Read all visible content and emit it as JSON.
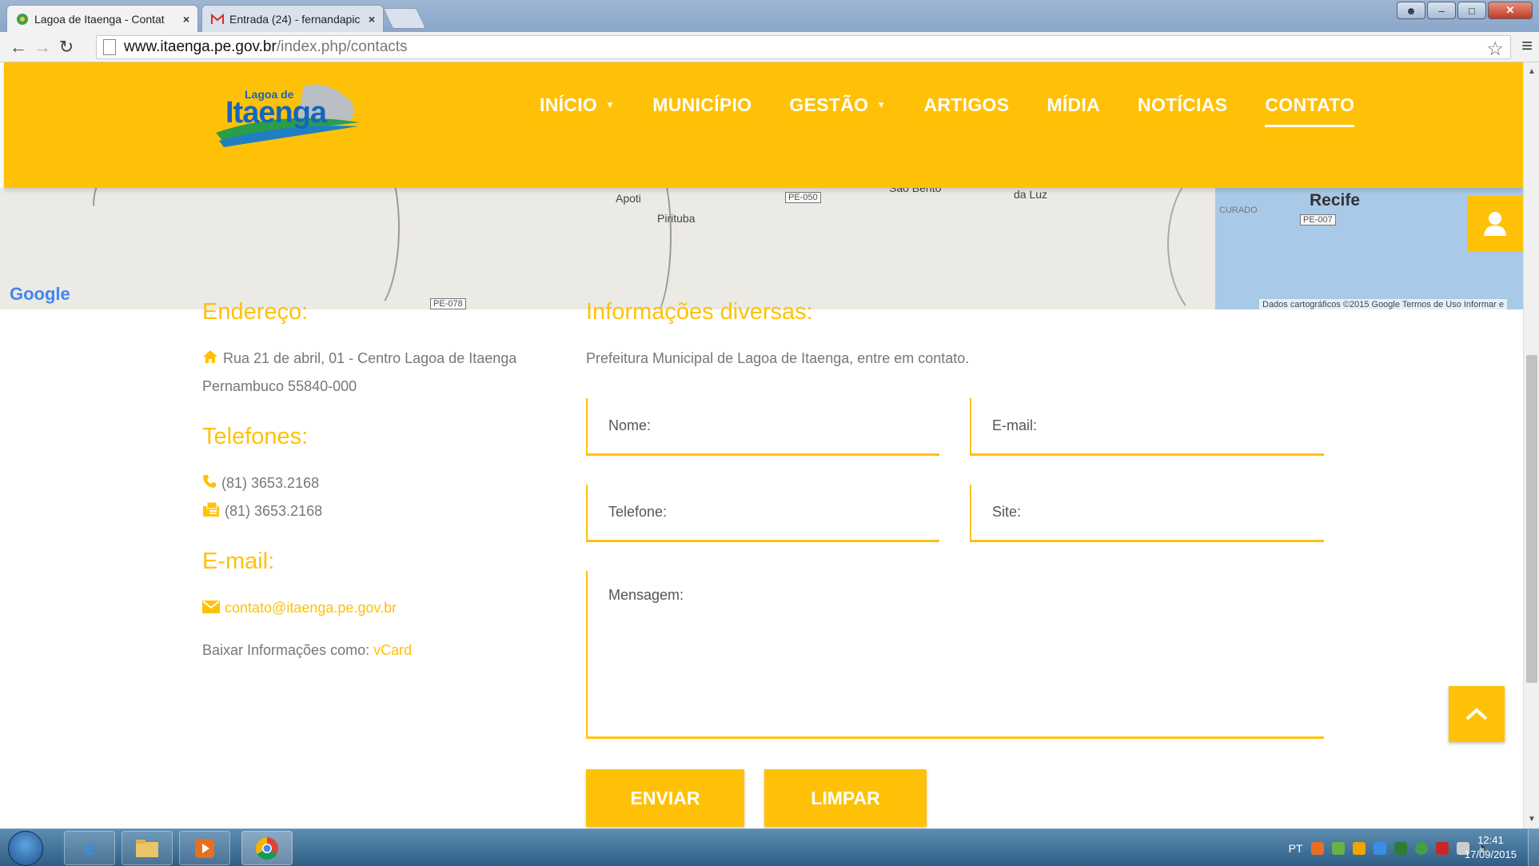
{
  "browser": {
    "tabs": [
      {
        "title": "Lagoa de Itaenga - Contat",
        "close": "×"
      },
      {
        "title": "Entrada (24) - fernandapic",
        "close": "×"
      }
    ],
    "url_host": "www.itaenga.pe.gov.br",
    "url_path": "/index.php/contacts"
  },
  "site": {
    "logo_top": "Lagoa de",
    "logo_main": "Itaenga",
    "nav": [
      {
        "label": "INÍCIO",
        "has_caret": true
      },
      {
        "label": "MUNICÍPIO",
        "has_caret": false
      },
      {
        "label": "GESTÃO",
        "has_caret": true
      },
      {
        "label": "ARTIGOS",
        "has_caret": false
      },
      {
        "label": "MÍDIA",
        "has_caret": false
      },
      {
        "label": "NOTÍCIAS",
        "has_caret": false
      },
      {
        "label": "CONTATO",
        "has_caret": false,
        "active": true
      }
    ]
  },
  "map": {
    "labels": {
      "apoti": "Apoti",
      "pirituba": "Pirituba",
      "sao_bento": "São Bento",
      "da_luz": "da Luz",
      "recife": "Recife",
      "curado": "CURADO"
    },
    "shields": {
      "pe050": "PE-050",
      "pe078": "PE-078",
      "pe007": "PE-007"
    },
    "google": "Google",
    "attribution": "Dados cartográficos ©2015 Google   Termos de Uso   Informar e"
  },
  "contact": {
    "address_heading": "Endereço:",
    "address_line1": "Rua 21 de abril, 01 - Centro Lagoa de Itaenga",
    "address_line2": "Pernambuco 55840-000",
    "phones_heading": "Telefones:",
    "phone": "(81) 3653.2168",
    "fax": "(81) 3653.2168",
    "email_heading": "E-mail:",
    "email": "contato@itaenga.pe.gov.br",
    "vcard_prefix": "Baixar Informações como:",
    "vcard_link": "vCard"
  },
  "form": {
    "heading": "Informações diversas:",
    "intro": "Prefeitura Municipal de Lagoa de Itaenga, entre em contato.",
    "name_placeholder": "Nome:",
    "email_placeholder": "E-mail:",
    "phone_placeholder": "Telefone:",
    "site_placeholder": "Site:",
    "message_placeholder": "Mensagem:",
    "send_label": "ENVIAR",
    "clear_label": "LIMPAR"
  },
  "taskbar": {
    "language": "PT",
    "time": "12:41",
    "date": "17/09/2015"
  },
  "colors": {
    "accent": "#ffc107",
    "text": "#777777"
  }
}
